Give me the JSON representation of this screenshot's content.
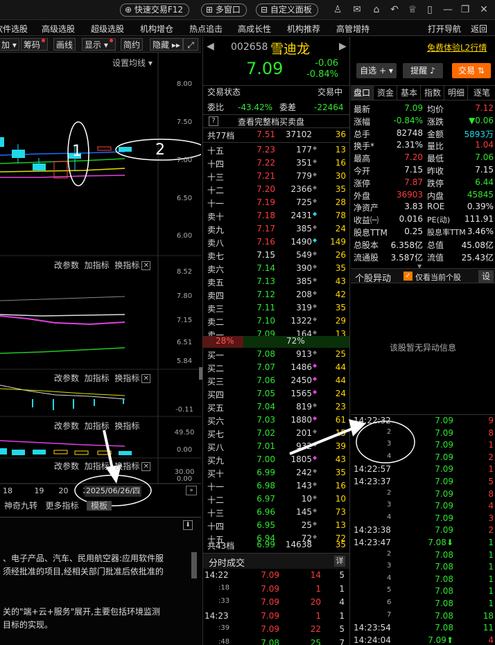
{
  "topbar": {
    "quick_trade": "快速交易F12",
    "multi_window": "多窗口",
    "custom_panel": "自定义面板"
  },
  "menu": [
    "软件选股",
    "高级选股",
    "超级选股",
    "机构增仓",
    "热点追击",
    "高成长性",
    "机构推荐",
    "高管增持",
    "打开导航",
    "返回"
  ],
  "toolbar": {
    "items": [
      "加",
      "筹码",
      "画线",
      "显示",
      "简约",
      "隐藏"
    ],
    "ma_setting": "设置均线"
  },
  "chart": {
    "main_axis": [
      "8.00",
      "7.50",
      "7.00",
      "6.50",
      "6.00"
    ],
    "panel2_axis": [
      "8.52",
      "7.80",
      "7.15",
      "6.51",
      "5.84"
    ],
    "panel3_axis": [
      "-0.11"
    ],
    "panel4_axis": [
      "49.50",
      "0.00"
    ],
    "panel5_axis": [
      "30.00",
      "0.00"
    ],
    "panel_tools": {
      "params": "改参数",
      "add_indicator": "加指标",
      "switch_indicator": "换指标",
      "close": "✕"
    },
    "x_labels": [
      "18",
      "19",
      "20",
      "23"
    ],
    "date_label": "2025/06/26/四",
    "bottom_tabs": [
      "神奇九转",
      "更多指标",
      "模板"
    ],
    "annotations": [
      "1",
      "2"
    ]
  },
  "description": [
    "、电子产品、汽车、民用航空器:应用软件服",
    "须经批准的项目,经相关部门批准后依批准的",
    "关的\"端+云+服务\"展开,主要包括环境监测",
    "目标的实现。"
  ],
  "stock": {
    "code": "002658",
    "name": "雪迪龙",
    "price": "7.09",
    "change": "-0.06",
    "change_pct": "-0.84%",
    "watchlist": "自选",
    "alert": "提醒",
    "trade": "交易",
    "free_l2": "免费体验L2行情"
  },
  "orderbook": {
    "status_label": "交易状态",
    "status_value": "交易中",
    "ratio_label": "委比",
    "ratio_value": "-43.42%",
    "diff_label": "委差",
    "diff_value": "-22464",
    "view_full": "查看完整档买卖盘",
    "help": "?",
    "asks_header": {
      "label": "共77档",
      "price": "7.51",
      "vol": "37102",
      "cnt": "36"
    },
    "asks": [
      {
        "label": "十五",
        "price": "7.23",
        "vol": "177",
        "cnt": "13"
      },
      {
        "label": "十四",
        "price": "7.22",
        "vol": "351",
        "cnt": "16"
      },
      {
        "label": "十三",
        "price": "7.21",
        "vol": "779",
        "cnt": "30"
      },
      {
        "label": "十二",
        "price": "7.20",
        "vol": "2366",
        "cnt": "35"
      },
      {
        "label": "十一",
        "price": "7.19",
        "vol": "725",
        "cnt": "28"
      },
      {
        "label": "卖十",
        "price": "7.18",
        "vol": "2431",
        "cnt": "78"
      },
      {
        "label": "卖九",
        "price": "7.17",
        "vol": "385",
        "cnt": "24"
      },
      {
        "label": "卖八",
        "price": "7.16",
        "vol": "1490",
        "cnt": "149"
      },
      {
        "label": "卖七",
        "price": "7.15",
        "vol": "549",
        "cnt": "26"
      },
      {
        "label": "卖六",
        "price": "7.14",
        "vol": "390",
        "cnt": "35"
      },
      {
        "label": "卖五",
        "price": "7.13",
        "vol": "385",
        "cnt": "43"
      },
      {
        "label": "卖四",
        "price": "7.12",
        "vol": "208",
        "cnt": "42"
      },
      {
        "label": "卖三",
        "price": "7.11",
        "vol": "319",
        "cnt": "35"
      },
      {
        "label": "卖二",
        "price": "7.10",
        "vol": "1322",
        "cnt": "29"
      },
      {
        "label": "卖一",
        "price": "7.09",
        "vol": "164",
        "cnt": "13"
      }
    ],
    "sell_pct": "28%",
    "buy_pct": "72%",
    "bids": [
      {
        "label": "买一",
        "price": "7.08",
        "vol": "913",
        "cnt": "25"
      },
      {
        "label": "买二",
        "price": "7.07",
        "vol": "1486",
        "cnt": "44"
      },
      {
        "label": "买三",
        "price": "7.06",
        "vol": "2450",
        "cnt": "44"
      },
      {
        "label": "买四",
        "price": "7.05",
        "vol": "1565",
        "cnt": "24"
      },
      {
        "label": "买五",
        "price": "7.04",
        "vol": "819",
        "cnt": "23"
      },
      {
        "label": "买六",
        "price": "7.03",
        "vol": "1880",
        "cnt": "61"
      },
      {
        "label": "买七",
        "price": "7.02",
        "vol": "201",
        "cnt": "15"
      },
      {
        "label": "买八",
        "price": "7.01",
        "vol": "932",
        "cnt": "39"
      },
      {
        "label": "买九",
        "price": "7.00",
        "vol": "1805",
        "cnt": "43"
      },
      {
        "label": "买十",
        "price": "6.99",
        "vol": "242",
        "cnt": "35"
      },
      {
        "label": "十一",
        "price": "6.98",
        "vol": "143",
        "cnt": "16"
      },
      {
        "label": "十二",
        "price": "6.97",
        "vol": "10",
        "cnt": "10"
      },
      {
        "label": "十三",
        "price": "6.96",
        "vol": "145",
        "cnt": "73"
      },
      {
        "label": "十四",
        "price": "6.95",
        "vol": "25",
        "cnt": "13"
      },
      {
        "label": "十五",
        "price": "6.94",
        "vol": "72",
        "cnt": "72"
      }
    ],
    "bids_footer": {
      "label": "共43档",
      "price": "6.99",
      "vol": "14638",
      "cnt": "35"
    }
  },
  "time_sales": {
    "title": "分时成交",
    "detail": "详",
    "rows": [
      {
        "t": "14:22",
        "p": "7.09",
        "v": "14",
        "c": "5",
        "vc": "red"
      },
      {
        "t": ":18",
        "p": "7.09",
        "v": "1",
        "c": "1",
        "vc": "red"
      },
      {
        "t": ":33",
        "p": "7.09",
        "v": "20",
        "c": "4",
        "vc": "red"
      },
      {
        "t": "14:23",
        "p": "7.09",
        "v": "1",
        "c": "1",
        "vc": "red"
      },
      {
        "t": ":39",
        "p": "7.09",
        "v": "22",
        "c": "5",
        "vc": "red"
      },
      {
        "t": ":48",
        "p": "7.08",
        "v": "25",
        "c": "7",
        "vc": "green"
      }
    ]
  },
  "quote": {
    "tabs": [
      "盘口",
      "资金",
      "基本",
      "指数",
      "明细",
      "逐笔"
    ],
    "rows": [
      {
        "l1": "最新",
        "v1": "7.09",
        "c1": "green",
        "l2": "均价",
        "v2": "7.12",
        "c2": "red"
      },
      {
        "l1": "涨幅",
        "v1": "-0.84%",
        "c1": "green",
        "l2": "涨跌",
        "v2": "▼0.06",
        "c2": "green"
      },
      {
        "l1": "总手",
        "v1": "82748",
        "c1": "white",
        "l2": "金额",
        "v2": "5893万",
        "c2": "cyan"
      },
      {
        "l1": "换手*",
        "v1": "2.31%",
        "c1": "white",
        "l2": "量比",
        "v2": "1.04",
        "c2": "red"
      },
      {
        "l1": "最高",
        "v1": "7.20",
        "c1": "red",
        "l2": "最低",
        "v2": "7.06",
        "c2": "green"
      },
      {
        "l1": "今开",
        "v1": "7.15",
        "c1": "white",
        "l2": "昨收",
        "v2": "7.15",
        "c2": "white"
      },
      {
        "l1": "涨停",
        "v1": "7.87",
        "c1": "red",
        "l2": "跌停",
        "v2": "6.44",
        "c2": "green"
      },
      {
        "l1": "外盘",
        "v1": "36903",
        "c1": "red",
        "l2": "内盘",
        "v2": "45845",
        "c2": "green"
      },
      {
        "l1": "净资产",
        "v1": "3.83",
        "c1": "white",
        "l2": "ROE",
        "v2": "0.39%",
        "c2": "white"
      },
      {
        "l1": "收益㈠",
        "v1": "0.016",
        "c1": "white",
        "l2": "PE(动)",
        "v2": "111.91",
        "c2": "white"
      },
      {
        "l1": "股息TTM",
        "v1": "0.25",
        "c1": "white",
        "l2": "股息率TTM",
        "v2": "3.46%",
        "c2": "white"
      },
      {
        "l1": "总股本",
        "v1": "6.358亿",
        "c1": "white",
        "l2": "总值",
        "v2": "45.08亿",
        "c2": "white"
      },
      {
        "l1": "流通股",
        "v1": "3.587亿",
        "c1": "white",
        "l2": "流值",
        "v2": "25.43亿",
        "c2": "white"
      }
    ],
    "anomaly_title": "个股异动",
    "only_current": "仅看当前个股",
    "settings": "设",
    "no_anomaly": "该股暂无异动信息"
  },
  "ticks": [
    {
      "t": "14:22:32",
      "p": "7.09",
      "v": "9",
      "vc": "red"
    },
    {
      "t": "2",
      "p": "7.09",
      "v": "8",
      "vc": "red"
    },
    {
      "t": "3",
      "p": "7.09",
      "v": "1",
      "vc": "red"
    },
    {
      "t": "4",
      "p": "7.09",
      "v": "2",
      "vc": "red"
    },
    {
      "t": "14:22:57",
      "p": "7.09",
      "v": "1",
      "vc": "red"
    },
    {
      "t": "14:23:37",
      "p": "7.09",
      "v": "5",
      "vc": "red"
    },
    {
      "t": "2",
      "p": "7.09",
      "v": "8",
      "vc": "red"
    },
    {
      "t": "3",
      "p": "7.09",
      "v": "4",
      "vc": "red"
    },
    {
      "t": "4",
      "p": "7.09",
      "v": "3",
      "vc": "red"
    },
    {
      "t": "14:23:38",
      "p": "7.09",
      "v": "2",
      "vc": "red"
    },
    {
      "t": "14:23:47",
      "p": "7.08⬇",
      "v": "1",
      "vc": "green"
    },
    {
      "t": "2",
      "p": "7.08",
      "v": "1",
      "vc": "green"
    },
    {
      "t": "3",
      "p": "7.08",
      "v": "1",
      "vc": "green"
    },
    {
      "t": "4",
      "p": "7.08",
      "v": "1",
      "vc": "green"
    },
    {
      "t": "5",
      "p": "7.08",
      "v": "1",
      "vc": "green"
    },
    {
      "t": "6",
      "p": "7.08",
      "v": "1",
      "vc": "green"
    },
    {
      "t": "7",
      "p": "7.08",
      "v": "18",
      "vc": "green"
    },
    {
      "t": "14:23:54",
      "p": "7.08",
      "v": "11",
      "vc": "green"
    },
    {
      "t": "14:24:04",
      "p": "7.09⬆",
      "v": "4",
      "vc": "red"
    }
  ]
}
